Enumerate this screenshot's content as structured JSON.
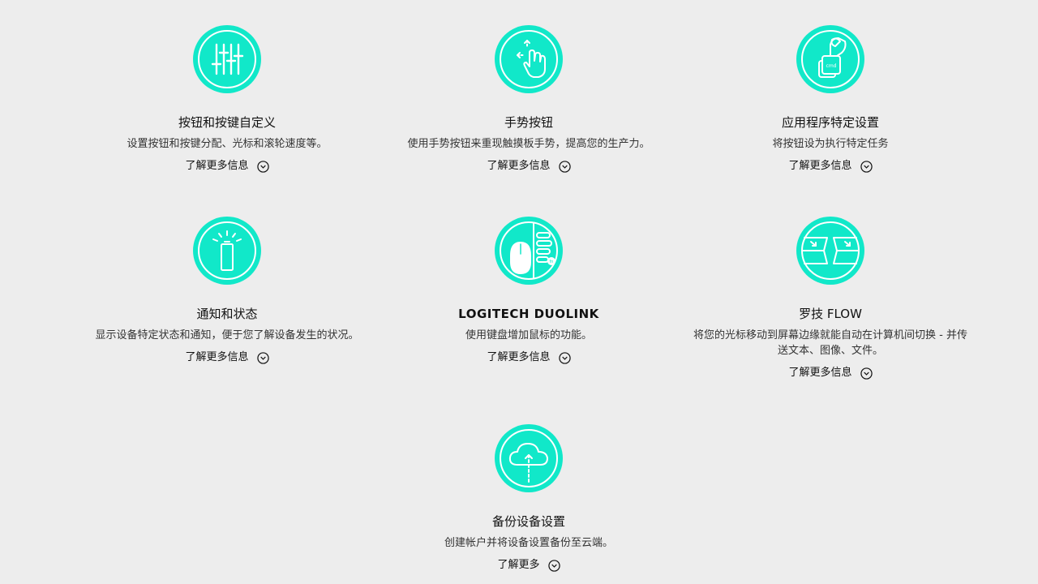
{
  "features": [
    {
      "title": "按钮和按键自定义",
      "desc": "设置按钮和按键分配、光标和滚轮速度等。",
      "more": "了解更多信息",
      "icon": "sliders-icon"
    },
    {
      "title": "手势按钮",
      "desc": "使用手势按钮来重现触摸板手势，提高您的生产力。",
      "more": "了解更多信息",
      "icon": "hand-gesture-icon"
    },
    {
      "title": "应用程序特定设置",
      "desc": "将按钮设为执行特定任务",
      "more": "了解更多信息",
      "icon": "cmd-key-icon"
    },
    {
      "title": "通知和状态",
      "desc": "显示设备特定状态和通知，便于您了解设备发生的状况。",
      "more": "了解更多信息",
      "icon": "battery-icon"
    },
    {
      "title": "LOGITECH DUOLINK",
      "desc": "使用键盘增加鼠标的功能。",
      "more": "了解更多信息",
      "icon": "mouse-keyboard-icon"
    },
    {
      "title": "罗技 FLOW",
      "desc": "将您的光标移动到屏幕边缘就能自动在计算机间切换 - 并传送文本、图像、文件。",
      "more": "了解更多信息",
      "icon": "flow-screens-icon"
    },
    {
      "title": "备份设备设置",
      "desc": "创建帐户并将设备设置备份至云端。",
      "more": "了解更多",
      "icon": "cloud-upload-icon"
    }
  ],
  "colors": {
    "accent": "#11e8c9",
    "background": "#ededed"
  }
}
